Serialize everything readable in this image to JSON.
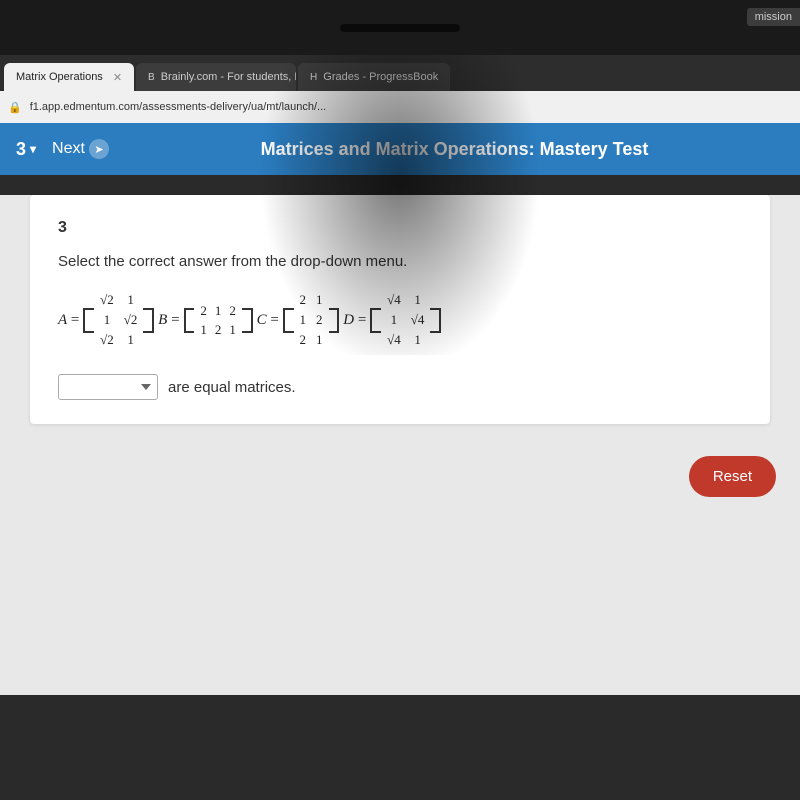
{
  "bezel": {
    "mission_label": "mission"
  },
  "browser": {
    "tabs": [
      {
        "label": "Matrix Operations",
        "active": true,
        "favicon": ""
      },
      {
        "label": "Brainly.com - For students, By...",
        "active": false,
        "favicon": "B"
      },
      {
        "label": "Grades - ProgressBook",
        "active": false,
        "favicon": "H"
      }
    ],
    "address": "f1.app.edmentum.com/assessments-delivery/ua/mt/launch/..."
  },
  "app_header": {
    "question_num": "3",
    "chevron": "▾",
    "next_label": "Next",
    "title": "Matrices and Matrix Operations: Mastery Test"
  },
  "question": {
    "number": "3",
    "instruction": "Select the correct answer from the drop-down menu.",
    "matrices": {
      "A_label": "A =",
      "B_label": "B =",
      "C_label": "C =",
      "D_label": "D ="
    },
    "answer_suffix": "are equal matrices.",
    "dropdown_placeholder": ""
  },
  "buttons": {
    "reset": "Reset",
    "next": "Next"
  }
}
